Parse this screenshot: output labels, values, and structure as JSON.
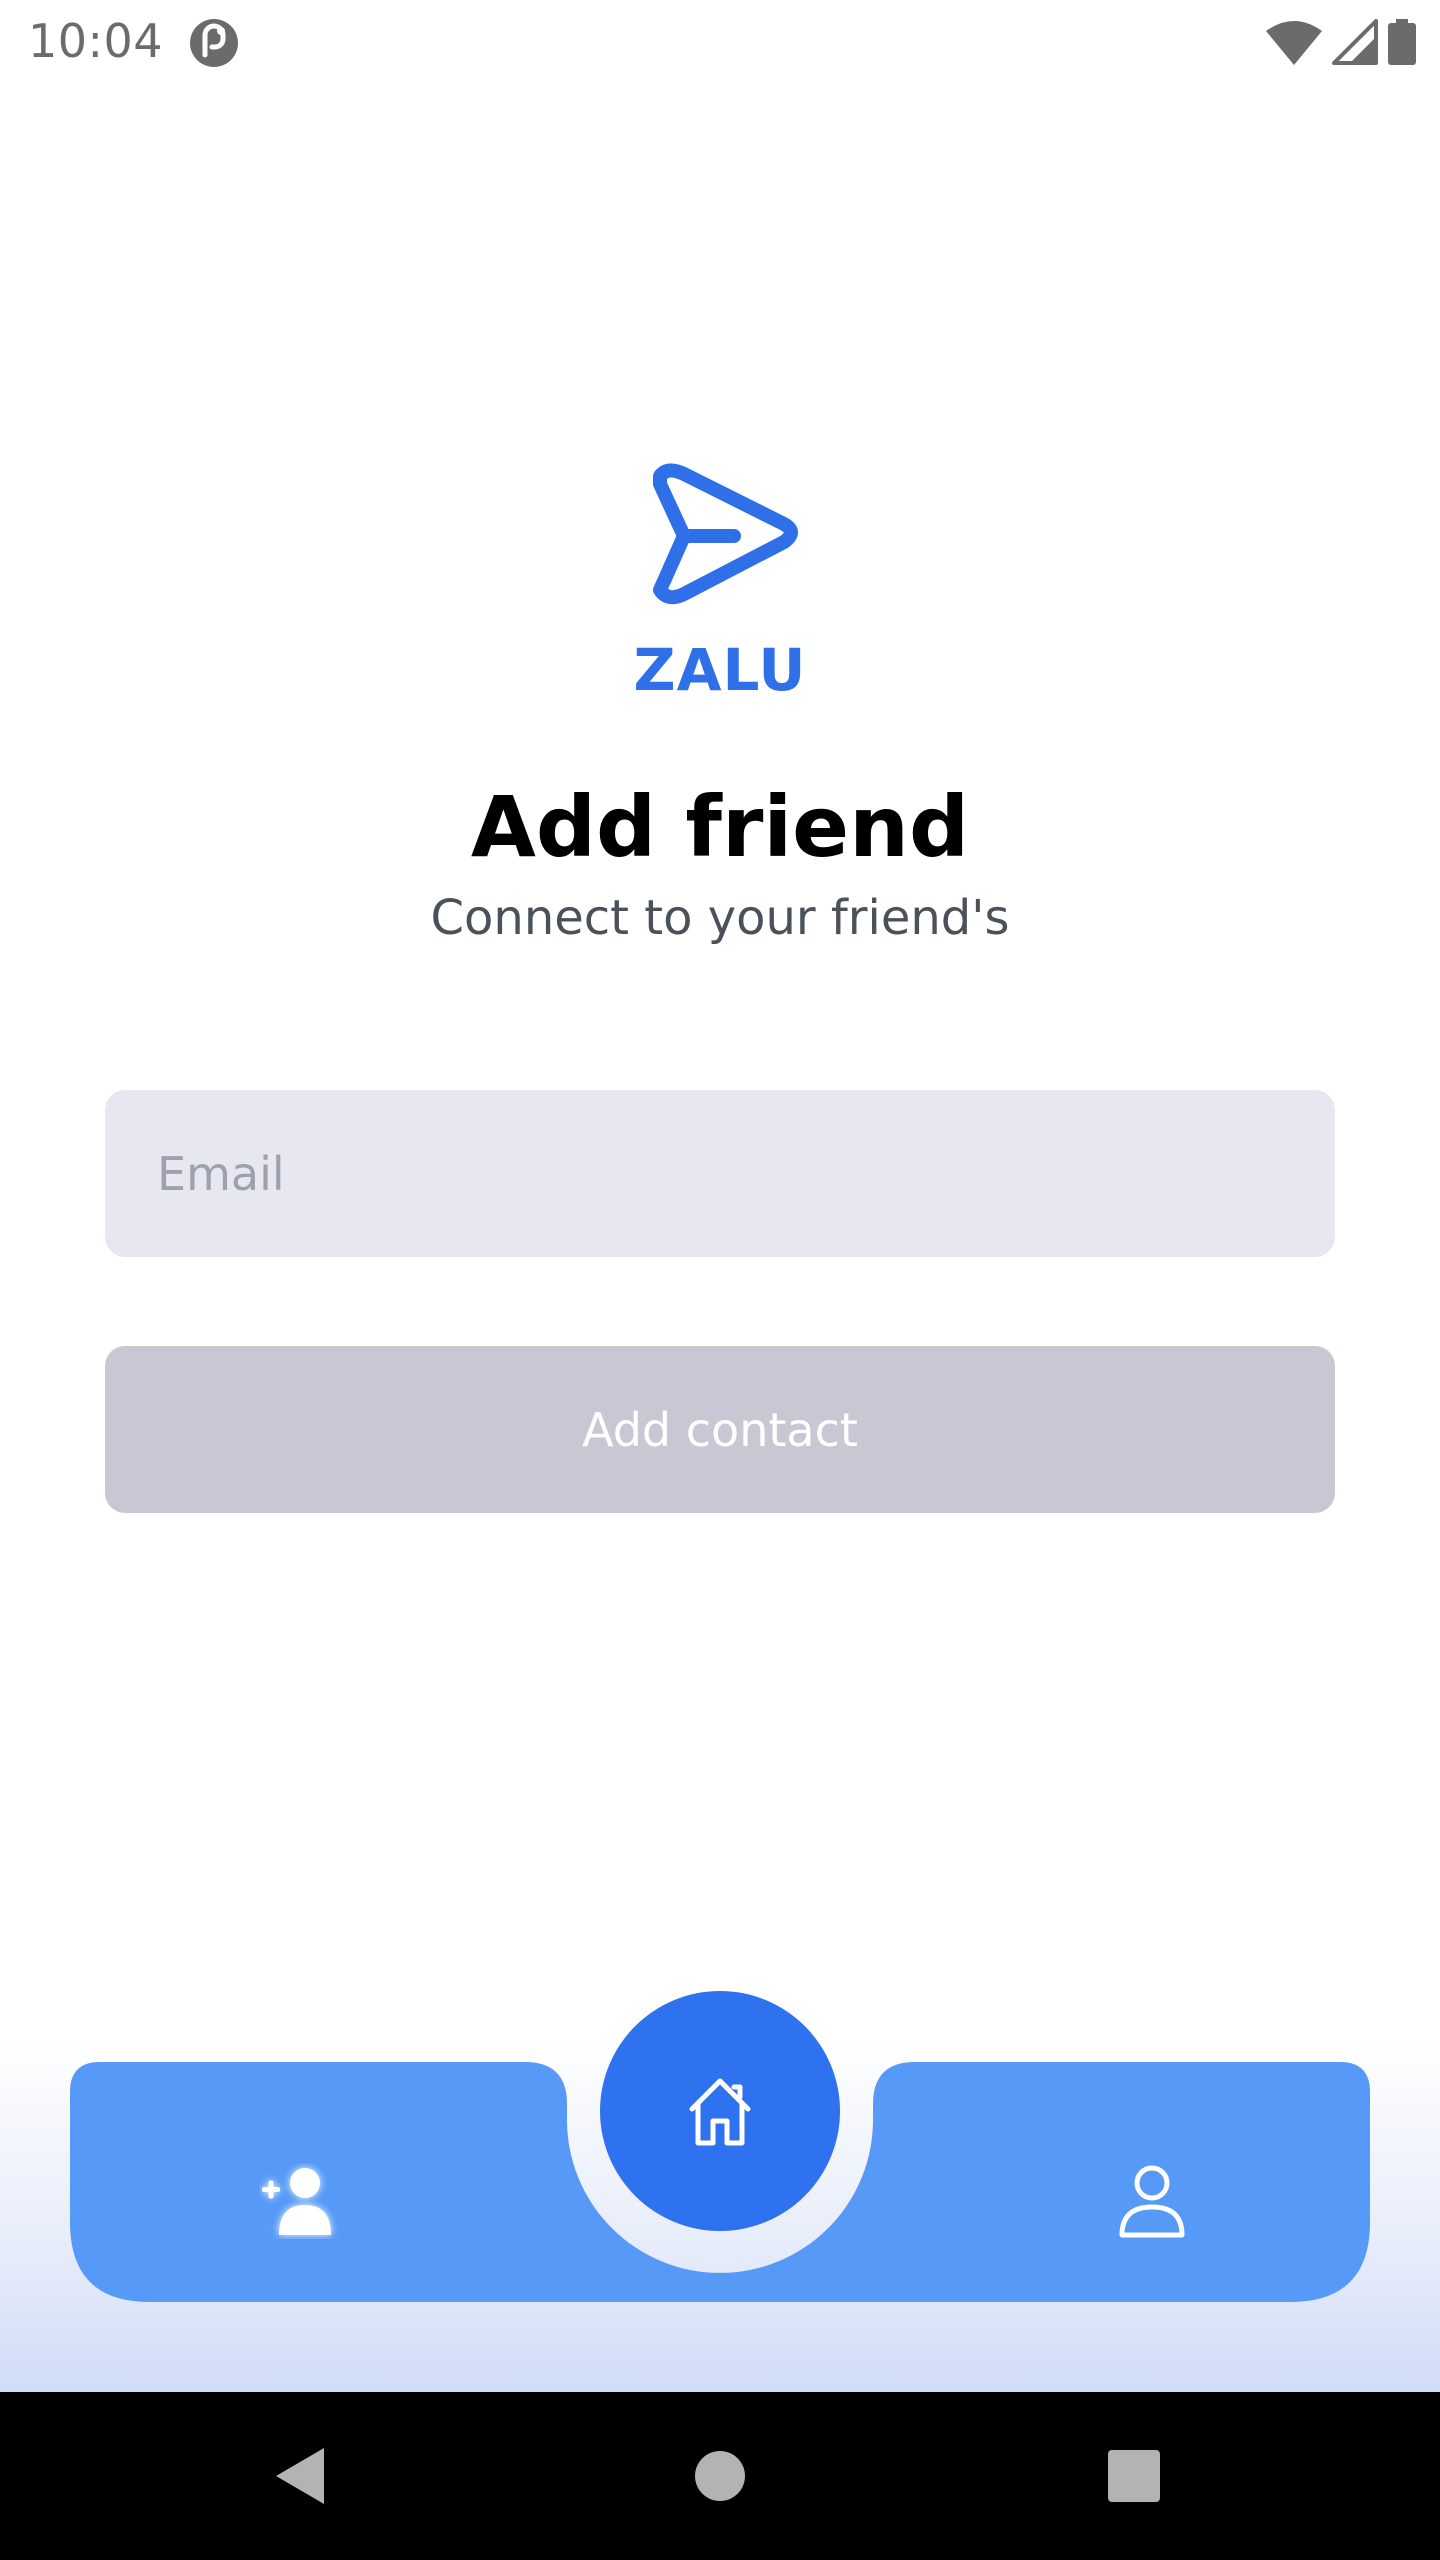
{
  "status_bar": {
    "time": "10:04",
    "icons": [
      "app-notification-icon",
      "wifi-icon",
      "cell-signal-icon",
      "battery-icon"
    ]
  },
  "brand": {
    "name": "ZALU",
    "logo_icon": "paper-plane-icon",
    "color": "#2f6fe8"
  },
  "header": {
    "title": "Add friend",
    "subtitle": "Connect to your friend's"
  },
  "form": {
    "email_placeholder": "Email",
    "email_value": "",
    "submit_label": "Add contact",
    "submit_state": "disabled"
  },
  "tab_bar": {
    "items": [
      {
        "id": "add-friend",
        "icon": "add-user-icon",
        "active": true
      },
      {
        "id": "home",
        "icon": "home-icon",
        "active": false
      },
      {
        "id": "profile",
        "icon": "user-icon",
        "active": false
      }
    ],
    "bar_color": "#5699f6",
    "fab_color": "#2e72ef"
  },
  "system_nav": {
    "buttons": [
      "back-icon",
      "home-circle-icon",
      "recents-icon"
    ]
  }
}
